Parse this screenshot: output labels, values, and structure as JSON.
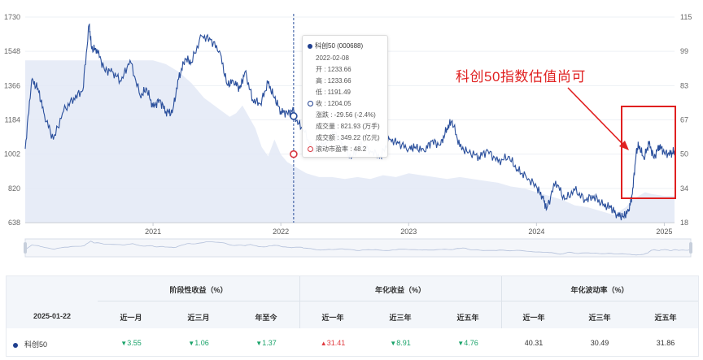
{
  "colors": {
    "price_line": "#2a4f9c",
    "area_fill": "#e3e9f6",
    "crosshair": "#2a4f9c",
    "pe_marker": "#d9363e",
    "highlight_box": "#e02020",
    "up": "#e0393e",
    "down": "#1aa36a"
  },
  "chart_data": {
    "type": "line",
    "y_left": {
      "ticks": [
        "1730",
        "1548",
        "1366",
        "1184",
        "1002",
        "820",
        "638"
      ],
      "range": [
        638,
        1730
      ]
    },
    "y_right": {
      "ticks": [
        "115",
        "99",
        "83",
        "67",
        "50",
        "34",
        "18"
      ],
      "range": [
        18,
        115
      ]
    },
    "x_ticks": [
      "2021",
      "2022",
      "2023",
      "2024",
      "2025"
    ],
    "series": [
      {
        "axis": "left",
        "x": [
          2020.0,
          2020.05,
          2020.1,
          2020.15,
          2020.22,
          2020.3,
          2020.38,
          2020.45,
          2020.5,
          2020.52,
          2020.56,
          2020.62,
          2020.68,
          2020.75,
          2020.82,
          2020.9,
          2020.95,
          2021.0,
          2021.05,
          2021.1,
          2021.15,
          2021.2,
          2021.25,
          2021.3,
          2021.38,
          2021.45,
          2021.52,
          2021.58,
          2021.63,
          2021.68,
          2021.72,
          2021.78,
          2021.84,
          2021.9,
          2021.95,
          2022.0,
          2022.05,
          2022.1,
          2022.12,
          2022.18,
          2022.25,
          2022.3,
          2022.35,
          2022.42,
          2022.48,
          2022.55,
          2022.62,
          2022.7,
          2022.78,
          2022.85,
          2022.92,
          2023.0,
          2023.05,
          2023.12,
          2023.18,
          2023.25,
          2023.3,
          2023.34,
          2023.4,
          2023.47,
          2023.55,
          2023.62,
          2023.7,
          2023.78,
          2023.85,
          2023.92,
          2024.0,
          2024.05,
          2024.08,
          2024.15,
          2024.22,
          2024.3,
          2024.38,
          2024.45,
          2024.52,
          2024.58,
          2024.63,
          2024.68,
          2024.72,
          2024.75,
          2024.78,
          2024.8,
          2024.84,
          2024.88,
          2024.92,
          2024.96,
          2025.0,
          2025.05,
          2025.08
        ],
        "y": [
          1030,
          1395,
          1350,
          1210,
          1080,
          1230,
          1300,
          1340,
          1690,
          1560,
          1560,
          1450,
          1440,
          1390,
          1500,
          1310,
          1350,
          1250,
          1290,
          1230,
          1220,
          1400,
          1510,
          1490,
          1630,
          1610,
          1550,
          1370,
          1390,
          1350,
          1440,
          1290,
          1270,
          1380,
          1300,
          1230,
          1220,
          1233,
          1180,
          1130,
          1020,
          1050,
          1055,
          1120,
          1060,
          980,
          1050,
          1020,
          990,
          1080,
          1060,
          1030,
          1040,
          1020,
          1070,
          1050,
          1140,
          1180,
          1040,
          1010,
          990,
          1020,
          960,
          990,
          920,
          880,
          830,
          770,
          710,
          860,
          760,
          810,
          760,
          780,
          730,
          720,
          680,
          670,
          700,
          790,
          1010,
          1050,
          980,
          1060,
          980,
          1050,
          1010,
          1000,
          1020
        ]
      },
      {
        "axis": "left",
        "x": [
          2020.0,
          2020.1,
          2020.2,
          2020.3,
          2020.4,
          2020.5,
          2020.6,
          2020.7,
          2020.8,
          2020.9,
          2021.0,
          2021.1,
          2021.2,
          2021.3,
          2021.4,
          2021.5,
          2021.6,
          2021.65,
          2021.7,
          2021.75,
          2021.8,
          2021.85,
          2021.9,
          2021.95,
          2022.0,
          2022.05,
          2022.1,
          2022.15,
          2022.2,
          2022.3,
          2022.4,
          2022.5,
          2022.6,
          2022.7,
          2022.8,
          2022.9,
          2023.0,
          2023.1,
          2023.2,
          2023.3,
          2023.4,
          2023.5,
          2023.6,
          2023.7,
          2023.8,
          2023.9,
          2024.0,
          2024.1,
          2024.2,
          2024.3,
          2024.4,
          2024.5,
          2024.6,
          2024.7,
          2024.75,
          2024.8,
          2024.85,
          2024.9,
          2025.0,
          2025.08
        ],
        "y": [
          1500,
          1500,
          1500,
          1500,
          1500,
          1500,
          1500,
          1500,
          1500,
          1500,
          1500,
          1480,
          1440,
          1380,
          1300,
          1250,
          1200,
          1220,
          1260,
          1200,
          1140,
          1040,
          990,
          1080,
          1000,
          960,
          940,
          920,
          900,
          880,
          880,
          870,
          880,
          870,
          890,
          880,
          900,
          890,
          880,
          870,
          880,
          870,
          860,
          850,
          830,
          820,
          800,
          780,
          760,
          730,
          720,
          700,
          680,
          720,
          760,
          780,
          800,
          790,
          780,
          780
        ]
      }
    ],
    "crosshair_date": "2022-02-08"
  },
  "tooltip": {
    "name": "科创50",
    "code": "(000688)",
    "date": "2022-02-08",
    "open": "开 : 1233.66",
    "high": "高 : 1233.66",
    "low": "低 : 1191.49",
    "close": "收 : 1204.05",
    "change": "涨跌 : -29.56 (-2.4%)",
    "volume": "成交量 : 821.93 (万手)",
    "turnover": "成交额 : 349.22 (亿元)",
    "pe": "滚动市盈率 : 48.2"
  },
  "annotation": "科创50指数估值尚可",
  "table": {
    "date": "2025-01-22",
    "groups": [
      "阶段性收益（%）",
      "年化收益（%）",
      "年化波动率（%）"
    ],
    "subheads": [
      "近一月",
      "近三月",
      "年至今",
      "近一年",
      "近三年",
      "近五年",
      "近一年",
      "近三年",
      "近五年"
    ],
    "row": {
      "name": "科创50",
      "values": [
        {
          "text": "3.55",
          "dir": "down"
        },
        {
          "text": "1.06",
          "dir": "down"
        },
        {
          "text": "1.37",
          "dir": "down"
        },
        {
          "text": "31.41",
          "dir": "up"
        },
        {
          "text": "8.91",
          "dir": "down"
        },
        {
          "text": "4.76",
          "dir": "down"
        },
        {
          "text": "40.31",
          "dir": ""
        },
        {
          "text": "30.49",
          "dir": ""
        },
        {
          "text": "31.86",
          "dir": ""
        }
      ]
    }
  }
}
